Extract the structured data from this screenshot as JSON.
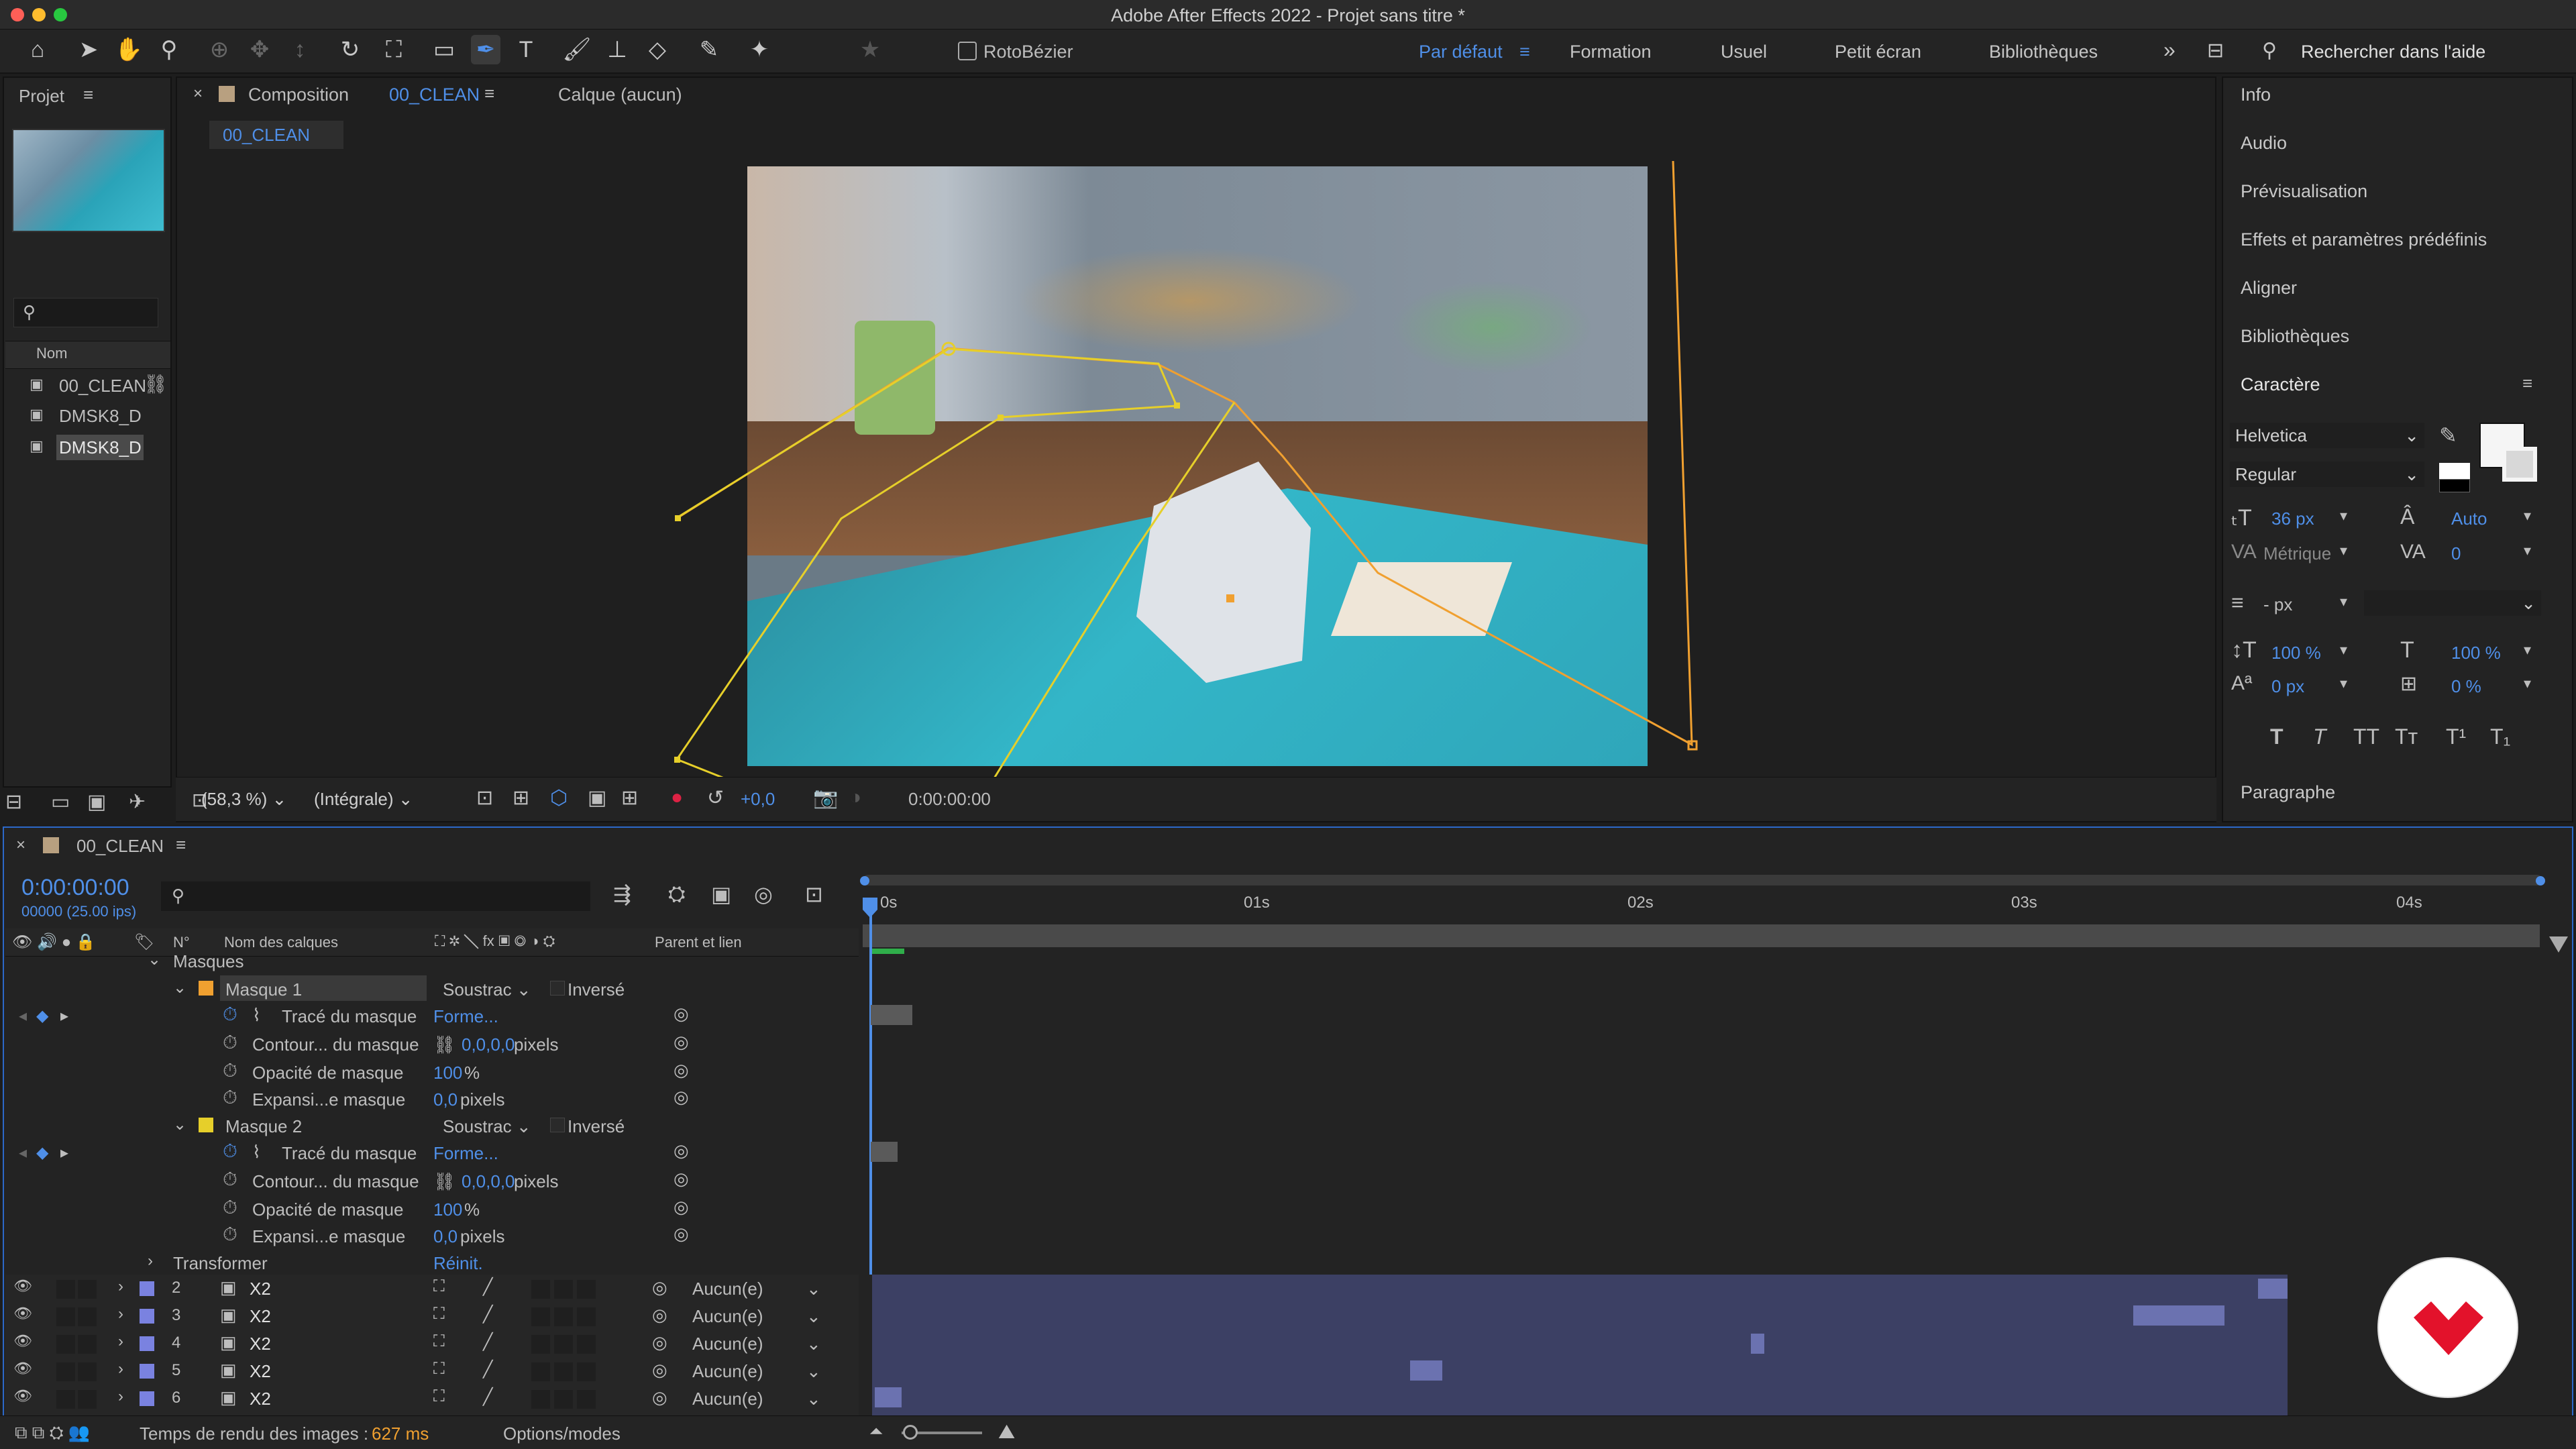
{
  "window": {
    "title": "Adobe After Effects 2022 - Projet sans titre *"
  },
  "toolbar": {
    "rotobezier": "RotoBézier",
    "workspaces": [
      "Par défaut",
      "Formation",
      "Usuel",
      "Petit écran",
      "Bibliothèques"
    ],
    "search_placeholder": "Rechercher dans l'aide"
  },
  "project": {
    "tab": "Projet",
    "column": "Nom",
    "items": [
      "00_CLEAN",
      "DMSK8_D",
      "DMSK8_D"
    ]
  },
  "comp": {
    "tab_label": "Composition",
    "tab_name": "00_CLEAN",
    "layer_tab": "Calque (aucun)",
    "subtab": "00_CLEAN",
    "zoom": "(58,3 %)",
    "resolution": "(Intégrale)",
    "exposure": "+0,0",
    "timecode": "0:00:00:00"
  },
  "right_panel": {
    "items": [
      "Info",
      "Audio",
      "Prévisualisation",
      "Effets et paramètres prédéfinis",
      "Aligner",
      "Bibliothèques"
    ],
    "character": "Caractère",
    "font": "Helvetica",
    "style": "Regular",
    "size": "36 px",
    "leading": "Auto",
    "kerning": "Métrique",
    "tracking": "0",
    "stroke": "- px",
    "vscale": "100 %",
    "hscale": "100 %",
    "baseline": "0 px",
    "tsume": "0 %",
    "paragraph": "Paragraphe",
    "type_buttons": [
      "T",
      "T",
      "TT",
      "Tт",
      "T¹",
      "T₁"
    ]
  },
  "timeline": {
    "tab": "00_CLEAN",
    "timecode": "0:00:00:00",
    "fps": "00000 (25.00 ips)",
    "col_name": "Nom des calques",
    "col_num": "N°",
    "col_parent": "Parent et lien",
    "ruler": [
      "0s",
      "01s",
      "02s",
      "03s",
      "04s"
    ],
    "masks_header": "Masques",
    "mask1": {
      "name": "Masque 1",
      "mode": "Soustrac",
      "inverted": "Inversé",
      "props": [
        {
          "name": "Tracé du masque",
          "value": "Forme..."
        },
        {
          "name": "Contour... du masque",
          "value": "0,0,0,0",
          "unit": " pixels"
        },
        {
          "name": "Opacité de masque",
          "value": "100",
          "unit": "%"
        },
        {
          "name": "Expansi...e masque",
          "value": "0,0",
          "unit": " pixels"
        }
      ]
    },
    "mask2": {
      "name": "Masque 2",
      "mode": "Soustrac",
      "inverted": "Inversé",
      "props": [
        {
          "name": "Tracé du masque",
          "value": "Forme..."
        },
        {
          "name": "Contour... du masque",
          "value": "0,0,0,0",
          "unit": " pixels"
        },
        {
          "name": "Opacité de masque",
          "value": "100",
          "unit": "%"
        },
        {
          "name": "Expansi...e masque",
          "value": "0,0",
          "unit": " pixels"
        }
      ]
    },
    "transform": {
      "name": "Transformer",
      "reset": "Réinit."
    },
    "layers": [
      {
        "num": "2",
        "name": "X2",
        "parent": "Aucun(e)"
      },
      {
        "num": "3",
        "name": "X2",
        "parent": "Aucun(e)"
      },
      {
        "num": "4",
        "name": "X2",
        "parent": "Aucun(e)"
      },
      {
        "num": "5",
        "name": "X2",
        "parent": "Aucun(e)"
      },
      {
        "num": "6",
        "name": "X2",
        "parent": "Aucun(e)"
      }
    ]
  },
  "status": {
    "render_label": "Temps de rendu des images :",
    "render_value": "627 ms",
    "options": "Options/modes"
  }
}
